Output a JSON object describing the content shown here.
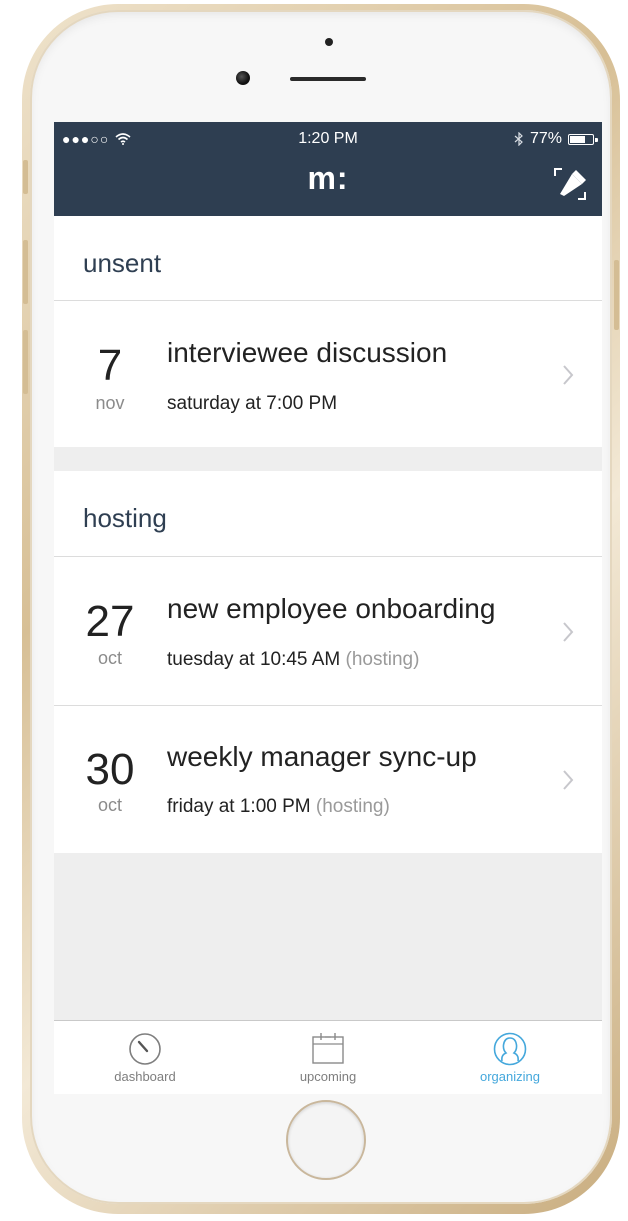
{
  "status_bar": {
    "signal": "●●●○○",
    "time": "1:20 PM",
    "battery_percent": "77%",
    "battery_level": 0.77
  },
  "header": {
    "logo": "m:"
  },
  "sections": [
    {
      "title": "unsent",
      "events": [
        {
          "day": "7",
          "month": "nov",
          "title": "interviewee discussion",
          "when": "saturday at 7:00 PM",
          "tag": ""
        }
      ]
    },
    {
      "title": "hosting",
      "events": [
        {
          "day": "27",
          "month": "oct",
          "title": "new employee onboarding",
          "when": "tuesday at 10:45 AM",
          "tag": "(hosting)"
        },
        {
          "day": "30",
          "month": "oct",
          "title": "weekly manager sync-up",
          "when": "friday at 1:00 PM",
          "tag": "(hosting)"
        }
      ]
    }
  ],
  "tabbar": {
    "tabs": [
      {
        "label": "dashboard",
        "icon": "dashboard-icon",
        "active": false
      },
      {
        "label": "upcoming",
        "icon": "calendar-icon",
        "active": false
      },
      {
        "label": "organizing",
        "icon": "person-icon",
        "active": true
      }
    ]
  },
  "colors": {
    "header_bg": "#2e3e51",
    "accent": "#45a8dc",
    "background": "#eeeeee"
  }
}
